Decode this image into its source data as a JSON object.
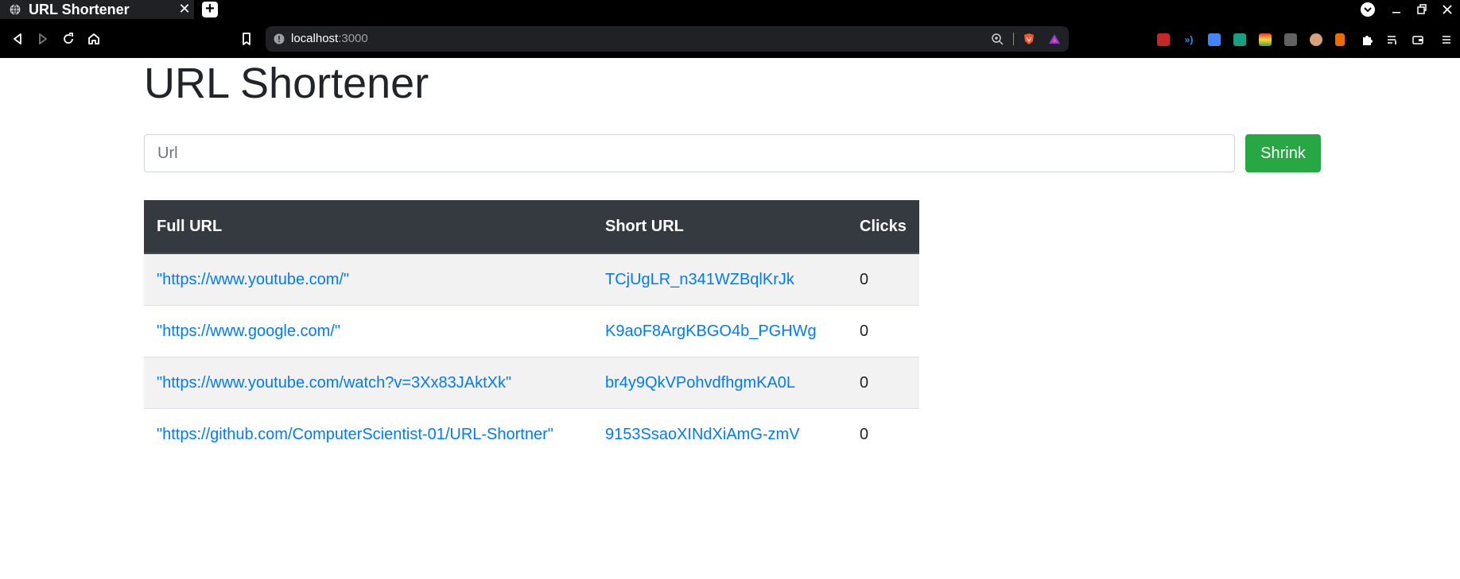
{
  "browser": {
    "tab_title": "URL Shortener",
    "tab_close": "✕",
    "new_tab": "+",
    "address": {
      "host": "localhost",
      "port": ":3000"
    }
  },
  "page": {
    "title": "URL Shortener",
    "input_placeholder": "Url",
    "input_value": "",
    "shrink_label": "Shrink"
  },
  "table": {
    "headers": [
      "Full URL",
      "Short URL",
      "Clicks"
    ],
    "rows": [
      {
        "full": "\"https://www.youtube.com/\"",
        "short": "TCjUgLR_n341WZBqlKrJk",
        "clicks": "0"
      },
      {
        "full": "\"https://www.google.com/\"",
        "short": "K9aoF8ArgKBGO4b_PGHWg",
        "clicks": "0"
      },
      {
        "full": "\"https://www.youtube.com/watch?v=3Xx83JAktXk\"",
        "short": "br4y9QkVPohvdfhgmKA0L",
        "clicks": "0"
      },
      {
        "full": "\"https://github.com/ComputerScientist-01/URL-Shortner\"",
        "short": "9153SsaoXINdXiAmG-zmV",
        "clicks": "0"
      }
    ]
  },
  "colors": {
    "shrink_green": "#28a745",
    "link_blue": "#007bff",
    "table_header": "#343a40",
    "stripe": "#f2f2f2"
  }
}
